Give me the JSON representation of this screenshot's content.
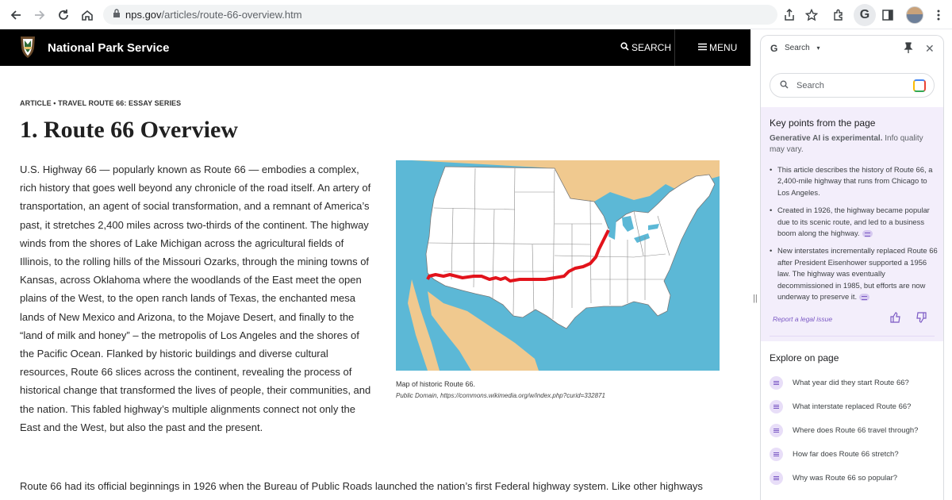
{
  "browser": {
    "url_domain": "nps.gov",
    "url_path": "/articles/route-66-overview.htm"
  },
  "site": {
    "name": "National Park Service",
    "search_label": "SEARCH",
    "menu_label": "MENU"
  },
  "article": {
    "kicker": "ARTICLE • TRAVEL ROUTE 66: ESSAY SERIES",
    "title": "1. Route 66 Overview",
    "paragraph1": "U.S. Highway 66 — popularly known as Route 66 — embodies a complex, rich history that goes well beyond any chronicle of the road itself. An artery of transportation, an agent of social transformation, and a remnant of America’s past, it stretches 2,400 miles across two-thirds of the continent. The highway winds from the shores of Lake Michigan across the agricultural fields of Illinois, to the rolling hills of the Missouri Ozarks, through the mining towns of Kansas, across Oklahoma where the woodlands of the East meet the open plains of the West, to the open ranch lands of Texas, the enchanted mesa lands of New Mexico and Arizona, to the Mojave Desert, and finally to the “land of milk and honey” – the metropolis of Los Angeles and the shores of the Pacific Ocean. Flanked by historic buildings and diverse cultural resources, Route 66 slices across the continent, revealing the process of historical change that transformed the lives of people, their communities, and the nation. This fabled highway’s multiple alignments connect not only the East and the West, but also the past and the present.",
    "map_caption": "Map of historic Route 66.",
    "map_credit": "Public Domain, https://commons.wikimedia.org/w/index.php?curid=332871",
    "paragraph2": "Route 66 had its official beginnings in 1926 when the Bureau of Public Roads launched the nation’s first Federal highway system. Like other highways"
  },
  "panel": {
    "header_label": "Search",
    "search_placeholder": "Search",
    "key_points_title": "Key points from the page",
    "disclaimer_bold": "Generative AI is experimental.",
    "disclaimer_rest": " Info quality may vary.",
    "key_points": [
      "This article describes the history of Route 66, a 2,400-mile highway that runs from Chicago to Los Angeles.",
      "Created in 1926, the highway became popular due to its scenic route, and led to a business boom along the highway.",
      "New interstates incrementally replaced Route 66 after President Eisenhower supported a 1956 law. The highway was eventually decommissioned in 1985, but efforts are now underway to preserve it."
    ],
    "report_link": "Report a legal issue",
    "explore_title": "Explore on page",
    "explore_items": [
      "What year did they start Route 66?",
      "What interstate replaced Route 66?",
      "Where does Route 66 travel through?",
      "How far does Route 66 stretch?",
      "Why was Route 66 so popular?"
    ]
  },
  "colors": {
    "route": "#e2131b",
    "ocean": "#5cb8d6",
    "foreign_land": "#f0c98f",
    "panel_accent": "#7b59c4"
  }
}
